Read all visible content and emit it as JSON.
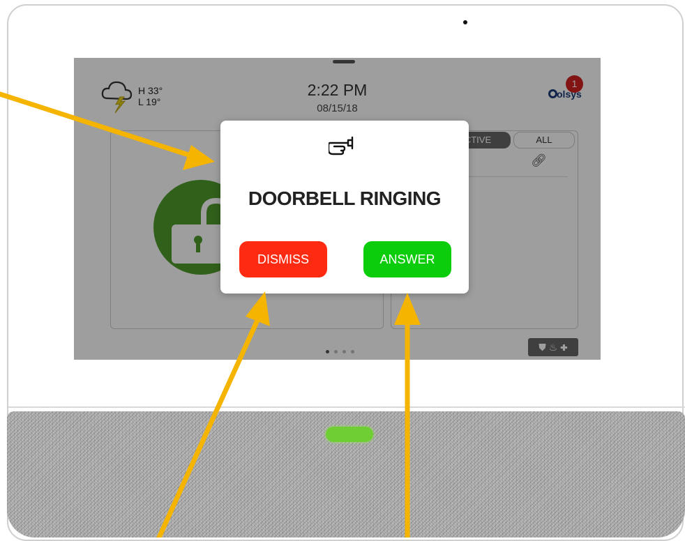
{
  "weather": {
    "icon": "thunderstorm-icon",
    "high": "H 33°",
    "low": "L 19°"
  },
  "clock": {
    "time": "2:22 PM",
    "date": "08/15/18"
  },
  "brand": {
    "name": "olsys",
    "notification_count": "1"
  },
  "tabs": {
    "active_label": "CTIVE",
    "all_label": "ALL"
  },
  "dialog": {
    "icon": "doorbell-icon",
    "title": "DOORBELL RINGING",
    "dismiss_label": "DISMISS",
    "answer_label": "ANSWER"
  },
  "quick_panel": {
    "icons": [
      "shield-icon",
      "fire-icon",
      "plus-icon"
    ],
    "glyphs": "⛊ ♨ ✚"
  },
  "colors": {
    "dismiss": "#ff2a12",
    "answer": "#0ccd0c",
    "annotation_arrow": "#f5b400",
    "unlocked": "#4f9b2d",
    "led": "#6fce33"
  }
}
